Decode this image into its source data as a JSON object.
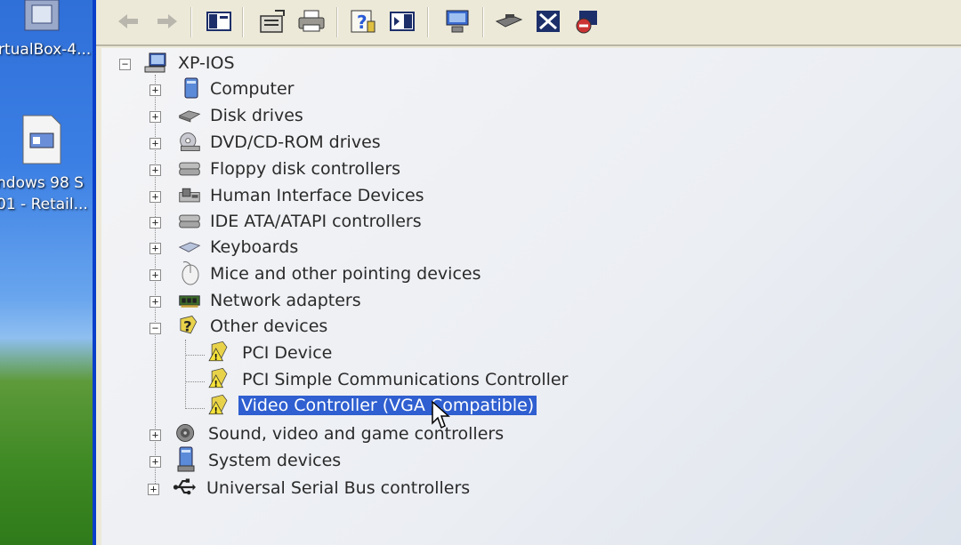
{
  "desktop": {
    "icon1_label": "rtualBox-4...",
    "icon2_label_line1": "ndows 98 S",
    "icon2_label_line2": "01 - Retail..."
  },
  "toolbar": {
    "buttons": [
      "back",
      "forward",
      "show-hide-console-tree",
      "properties",
      "print",
      "help",
      "action-pane",
      "scan-hardware",
      "update-driver",
      "uninstall",
      "disable"
    ]
  },
  "tree": {
    "root": "XP-IOS",
    "items": [
      {
        "label": "Computer",
        "icon": "computer-icon"
      },
      {
        "label": "Disk drives",
        "icon": "disk-drive-icon"
      },
      {
        "label": "DVD/CD-ROM drives",
        "icon": "cd-rom-icon"
      },
      {
        "label": "Floppy disk controllers",
        "icon": "floppy-controller-icon"
      },
      {
        "label": "Human Interface Devices",
        "icon": "hid-icon"
      },
      {
        "label": "IDE ATA/ATAPI controllers",
        "icon": "ide-controller-icon"
      },
      {
        "label": "Keyboards",
        "icon": "keyboard-icon"
      },
      {
        "label": "Mice and other pointing devices",
        "icon": "mouse-icon"
      },
      {
        "label": "Network adapters",
        "icon": "network-adapter-icon"
      },
      {
        "label": "Other devices",
        "icon": "unknown-device-icon"
      },
      {
        "label": "PCI Device",
        "icon": "warning-device-icon"
      },
      {
        "label": "PCI Simple Communications Controller",
        "icon": "warning-device-icon"
      },
      {
        "label": "Video Controller (VGA Compatible)",
        "icon": "warning-device-icon",
        "selected": true
      },
      {
        "label": "Sound, video and game controllers",
        "icon": "sound-icon"
      },
      {
        "label": "System devices",
        "icon": "system-device-icon"
      },
      {
        "label": "Universal Serial Bus controllers",
        "icon": "usb-icon"
      }
    ]
  },
  "colors": {
    "selection": "#2f5fd0",
    "window_border": "#0a3fc9"
  }
}
